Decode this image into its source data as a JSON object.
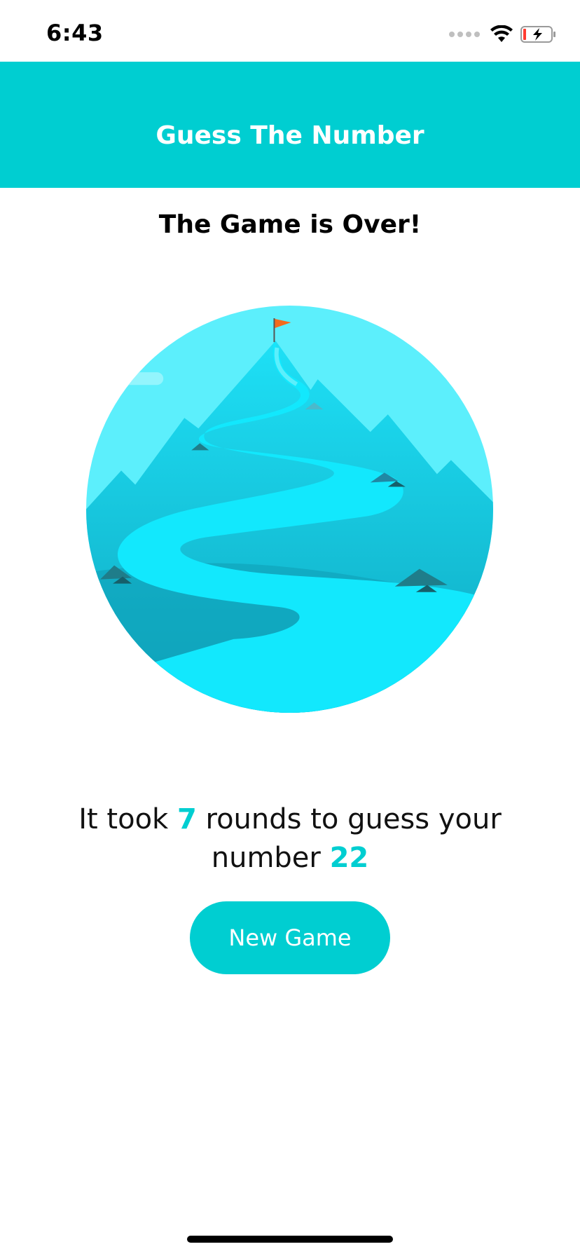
{
  "status_bar": {
    "time": "6:43",
    "icons": [
      "signal-icon",
      "wifi-icon",
      "battery-charging-icon"
    ]
  },
  "header": {
    "title": "Guess The Number",
    "background_color": "#00ced1"
  },
  "game_over": {
    "title": "The Game is Over!",
    "illustration": "mountain-summit-illustration",
    "result_prefix": "It took",
    "rounds": "7",
    "result_middle": "rounds to guess your number",
    "number": "22",
    "accent_color": "#00ced1"
  },
  "actions": {
    "new_game_label": "New Game"
  }
}
